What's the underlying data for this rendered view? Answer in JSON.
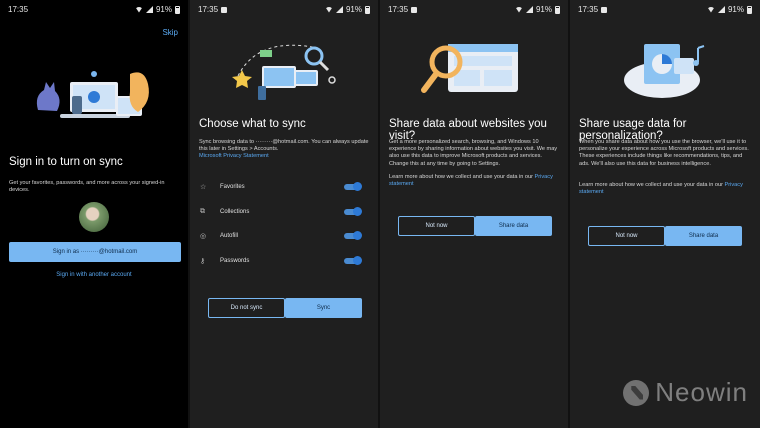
{
  "status_bar": {
    "time": "17:35",
    "battery": "91%"
  },
  "screen1": {
    "skip_label": "Skip",
    "title": "Sign in to turn on sync",
    "description": "Get your favorites, passwords, and more across your signed-in devices.",
    "sign_in_button": "Sign in as ·········@hotmail.com",
    "other_account_link": "Sign in with another account"
  },
  "screen2": {
    "title": "Choose what to sync",
    "description": "Sync browsing data to ·········@hotmail.com. You can always update this later in Settings > Accounts.",
    "privacy_link": "Microsoft Privacy Statement",
    "items": [
      {
        "label": "Favorites",
        "icon": "star-icon",
        "enabled": true
      },
      {
        "label": "Collections",
        "icon": "collections-icon",
        "enabled": true
      },
      {
        "label": "Autofill",
        "icon": "location-pin-icon",
        "enabled": true
      },
      {
        "label": "Passwords",
        "icon": "key-icon",
        "enabled": true
      }
    ],
    "secondary_button": "Do not sync",
    "primary_button": "Sync"
  },
  "screen3": {
    "title": "Share data about websites you visit?",
    "paragraph1": "Get a more personalized search, browsing, and Windows 10 experience by sharing information about websites you visit. We may also use this data to improve Microsoft products and services. Change this at any time by going to Settings.",
    "paragraph2_prefix": "Learn more about how we collect and use your data in our",
    "privacy_link": "Privacy statement",
    "secondary_button": "Not now",
    "primary_button": "Share data"
  },
  "screen4": {
    "title": "Share usage data for personalization?",
    "paragraph1": "When you share data about how you use the browser, we'll use it to personalize your experience across Microsoft products and services. These experiences include things like recommendations, tips, and ads. We'll also use this data for business intelligence.",
    "paragraph2_prefix": "Learn more about how we collect and use your data in our",
    "privacy_link": "Privacy statement",
    "secondary_button": "Not now",
    "primary_button": "Share data"
  },
  "watermark": {
    "text": "Neowin"
  },
  "colors": {
    "accent": "#78b7f2",
    "link": "#5aa9f2",
    "toggle": "#2e7ad6",
    "background": "#1f1f1f"
  }
}
